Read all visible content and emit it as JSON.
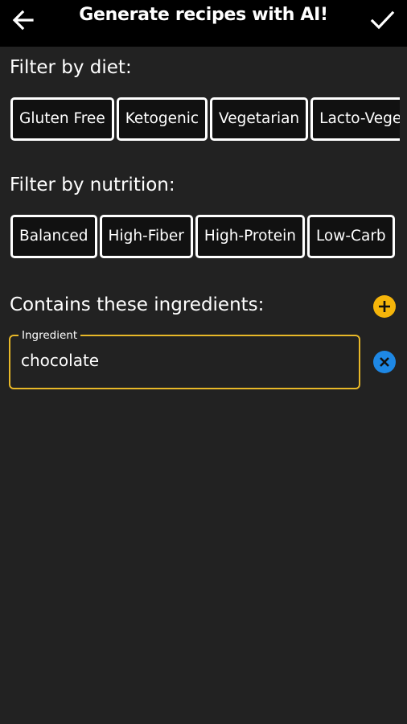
{
  "appbar": {
    "title": "Generate recipes with AI!",
    "back_icon": "arrow-left-icon",
    "confirm_icon": "checkmark-icon"
  },
  "diet": {
    "title": "Filter by diet:",
    "chips": [
      "Gluten Free",
      "Ketogenic",
      "Vegetarian",
      "Lacto-Vegetarian"
    ]
  },
  "nutrition": {
    "title": "Filter by nutrition:",
    "chips": [
      "Balanced",
      "High-Fiber",
      "High-Protein",
      "Low-Carb"
    ]
  },
  "ingredients": {
    "title": "Contains these ingredients:",
    "add_icon": "plus-circle-icon",
    "items": [
      {
        "label": "Ingredient",
        "value": "chocolate",
        "remove_icon": "close-circle-icon"
      }
    ]
  },
  "colors": {
    "background": "#222222",
    "appbar": "#000000",
    "accent_yellow": "#f5b50a",
    "remove_blue": "#1e88e5",
    "field_border": "#e8b828"
  }
}
